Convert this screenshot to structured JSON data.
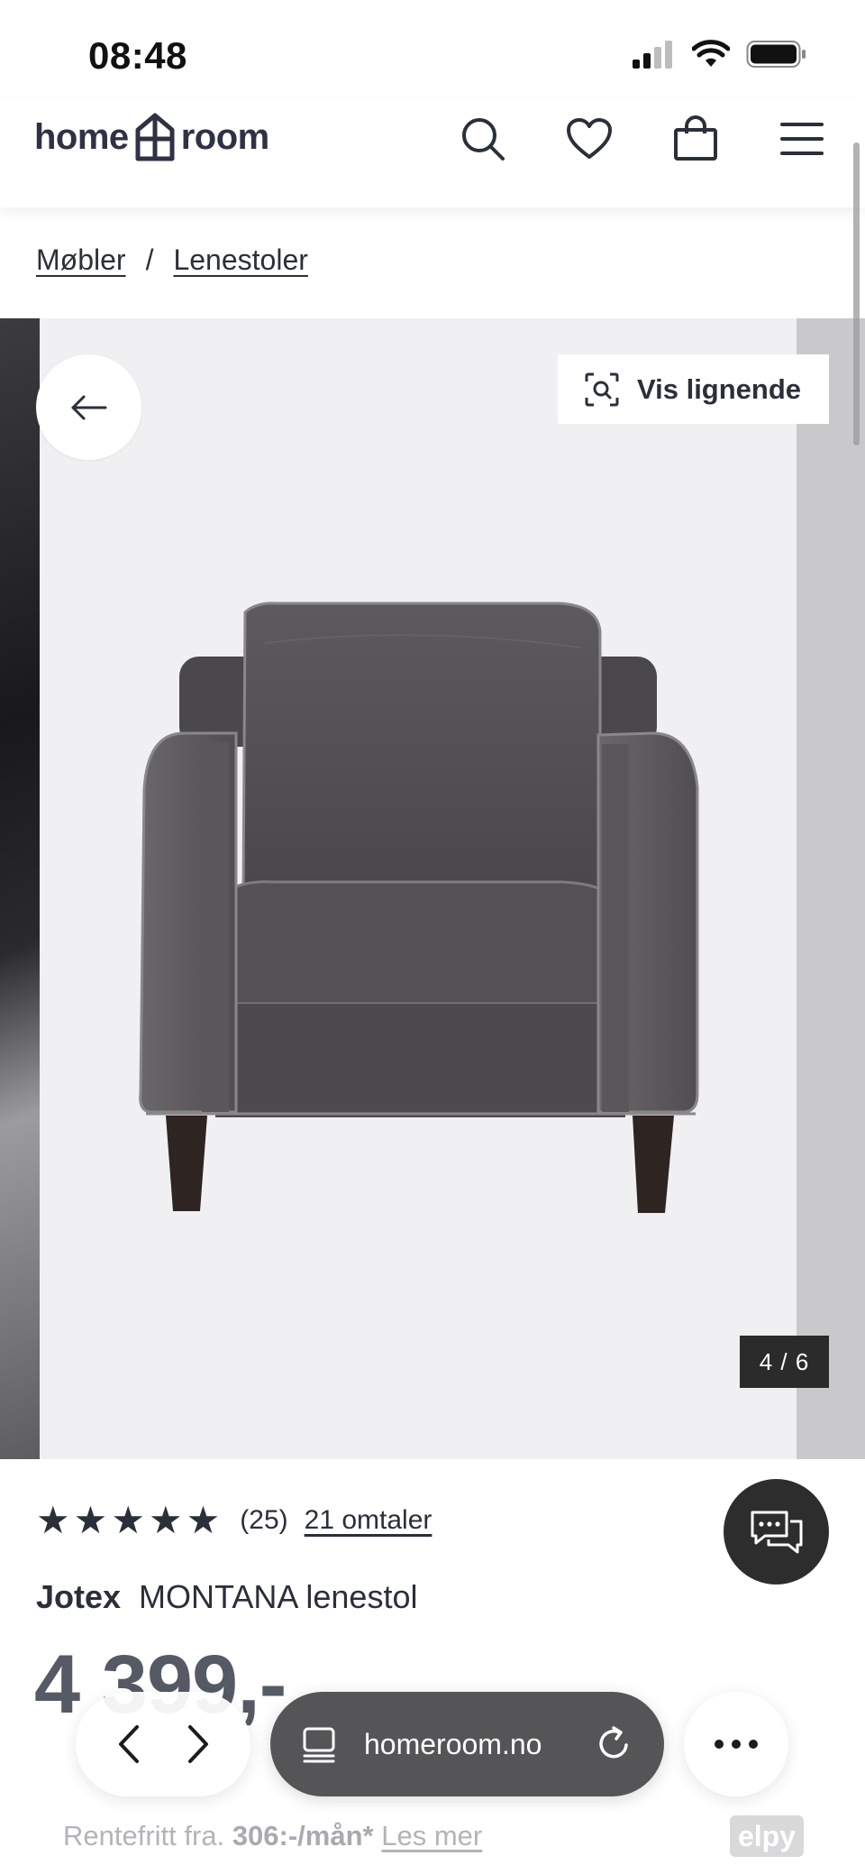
{
  "status_bar": {
    "time": "08:48",
    "icons": [
      "cellular-signal-icon",
      "wifi-icon",
      "battery-icon"
    ]
  },
  "header": {
    "logo_left": "home",
    "logo_right": "room",
    "icons": [
      "search-icon",
      "heart-icon",
      "shopping-bag-icon",
      "menu-icon"
    ]
  },
  "breadcrumb": {
    "items": [
      "Møbler",
      "Lenestoler"
    ],
    "separator": "/"
  },
  "gallery": {
    "similar_label": "Vis lignende",
    "counter": "4 / 6",
    "current": 4,
    "total": 6,
    "image_alt": "MONTANA lenestol"
  },
  "product": {
    "rating": 5,
    "rating_count": "(25)",
    "reviews_link": "21 omtaler",
    "brand": "Jotex",
    "name": "MONTANA lenestol",
    "price": "4 399,-"
  },
  "financing": {
    "prefix": "Rentefritt fra.",
    "amount": "306:-/mån*",
    "link": "Les mer",
    "provider": "elpy"
  },
  "browser": {
    "url": "homeroom.no"
  },
  "colors": {
    "text": "#2b2f3a",
    "gallery_bg": "#f0f0f2",
    "counter_bg": "#2b2b2b",
    "url_bar_bg": "#555558",
    "chat_bg": "#2d2d2d"
  }
}
